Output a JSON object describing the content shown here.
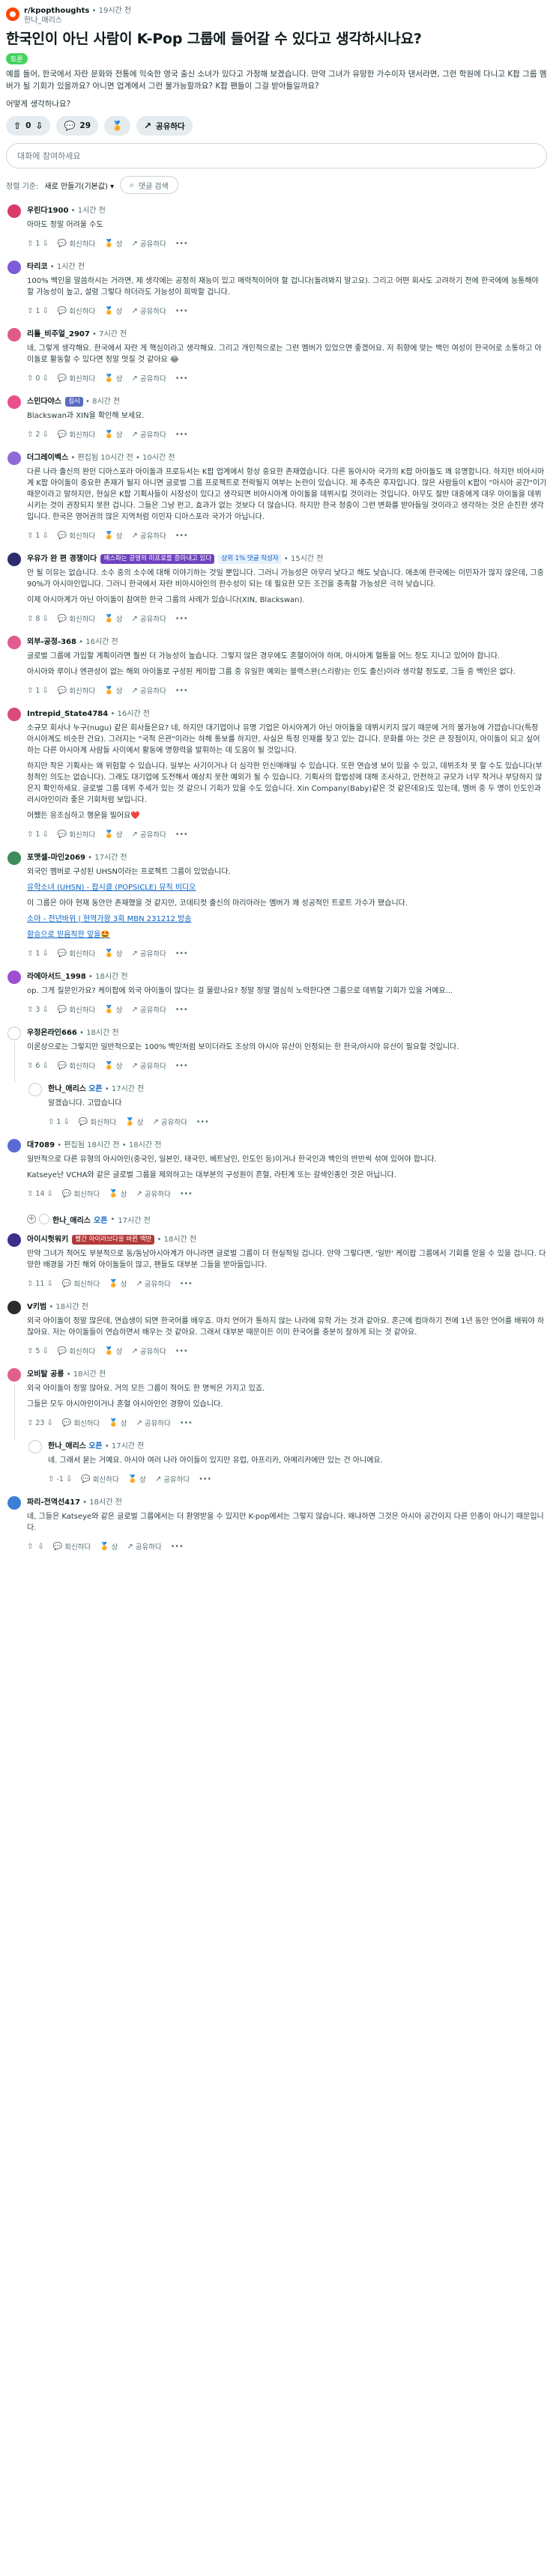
{
  "post": {
    "subreddit": "r/kpopthoughts",
    "time": "19시간 전",
    "author": "한나_애리스",
    "title": "한국인이 아닌 사람이 K-Pop 그룹에 들어갈 수 있다고 생각하시나요?",
    "flair": "토론",
    "body": [
      "예를 들어, 한국에서 자란 문화와 전통에 익숙한 영국 출신 소녀가 있다고 가정해 보겠습니다. 만약 그녀가 유망한 가수이자 댄서라면, 그런 학원에 다니고 K팝 그룹 멤버가 될 기회가 있을까요? 아니면 업계에서 그런 불가능할까요? K팝 팬들이 그걸 받아들일까요?",
      "어떻게 생각하나요?"
    ],
    "votes": "0",
    "comments_count": "29",
    "share_label": "공유하다"
  },
  "composer": {
    "placeholder": "대화에 참여하세요"
  },
  "sort": {
    "label": "정렬 기준:",
    "value": "새로 만들기(기본값)",
    "search_label": "댓글 검색"
  },
  "labels": {
    "reply": "회신하다",
    "award": "상",
    "share": "공유하다",
    "more": "•••",
    "edited": "편집됨"
  },
  "comments": [
    {
      "author": "우린다1900",
      "time": "1시간 전",
      "avatar_color": "#d93a6a",
      "body": [
        "아마도 정말 어려울 수도"
      ],
      "votes": "1"
    },
    {
      "author": "타리코",
      "time": "1시간 전",
      "avatar_color": "#7d5bd9",
      "body": [
        "100% 백인을 말씀하시는 거라면, 제 생각에는 공정히 재능이 있고 매력적이어야 할 겁니다(돌려봐지 말고요). 그리고 어떤 회사도 고려하기 전에 한국에에 능통해야 할 가능성이 높고, 설령 그렇다 하더라도 가능성이 희박할 겁니다."
      ],
      "votes": "1"
    },
    {
      "author": "리톨_비주얼_2907",
      "time": "7시간 전",
      "avatar_color": "#e05a8a",
      "body": [
        "네, 그렇게 생각해요. 한국에서 자란 게 핵심이라고 생각해요. 그리고 개인적으로는 그런 멤버가 있었으면 좋겠어요. 저 취향에 맞는 백인 여성이 한국어로 소통하고 아이돌로 활동할 수 있다면 정말 멋질 것 같아요 😂"
      ],
      "votes": "0"
    },
    {
      "author": "스민다야스",
      "time": "8시간 전",
      "avatar_color": "#e94f8b",
      "flair": "집시",
      "flair_color": "#5c6bc0",
      "body": [
        "Blackswan과 XIN을 확인해 보세요."
      ],
      "votes": "2"
    },
    {
      "author": "더그레이벡스",
      "time": "10시간 전",
      "edited": "10시간 전",
      "avatar_color": "#8e6bd8",
      "body": [
        "다른 나라 출신의 완인 디아스포라 아이돌과 프로듀서는 K팝 업계에서 항상 중요한 존재였습니다. 다른 동아시아 국가의 K팝 아이돌도 꽤 유명합니다. 하지만 비아시아계 K팝 아이돌이 중요한 존재가 될지 아니면 글로벌 그룹 프로젝트로 전락될지 여부는 논란이 있습니다. 제 추측은 후자입니다. 많은 사람들이 K팝이 \"아시아 공간\"이기 때문이라고 말하지만, 현실은 K팝 기획사들이 시장성이 있다고 생각되면 비아시아계 아이돌을 데뷔시킬 것이라는 것입니다. 아무도 절반 대중에게 대우 아이돌을 데뷔시키는 것이 권장되지 못한 겁니다. 그들은 그냥 펀고, 효과가 없는 것보다 더 많습니다. 하지만 한국 청중이 그런 변화를 받아들일 것이라고 생각하는 것은 순진한 생각입니다. 한국은 영어권의 많은 지역처럼 이민자 디아스포라 국가가 아닙니다."
      ],
      "votes": "1"
    },
    {
      "author": "우유가 완 편 경쟁이다",
      "time": "15시간 전",
      "avatar_color": "#2b2b6e",
      "flair": "예스파는 공영의 미프로를 증마내고 있다",
      "flair_color": "#6f42c1",
      "badge": "상위 1% 댓글 작성자",
      "body": [
        "안 될 이유는 없습니다. 소수 중의 소수에 대해 이야기하는 것일 뿐입니다. 그러니 가능성은 아무리 낮다고 해도 낮습니다. 애초에 한국에는 이민자가 많지 않은데, 그중 90%가 아시아인입니다. 그러니 한국에서 자란 비아시아인의 한수성이 되는 데 필요한 모든 조건을 충족할 가능성은 극히 낮습니다.",
        "이제 아시아계가 아닌 아이돌이 참여한 한국 그룹의 사례가 있습니다(XIN, Blackswan)."
      ],
      "votes": "8"
    },
    {
      "author": "외부-공정-368",
      "time": "16시간 전",
      "avatar_color": "#e15c8e",
      "body": [
        "글로벌 그룹에 가입할 계획이라면 훨씬 더 가능성이 높습니다. 그렇지 않은 경우에도 혼혈이어야 하며, 아시아계 혈통을 어느 정도 지니고 있어야 합니다.",
        "아시아와 루이나 엔관성이 없는 해외 아이돌로 구성된 케이팝 그룹 중 유일한 예외는 블랙스완(스리랑)는 인도 출신)이라 생각할 정도로, 그들 중 백인은 없다."
      ],
      "votes": "1"
    },
    {
      "author": "Intrepid_State4784",
      "time": "16시간 전",
      "avatar_color": "#d94c7a",
      "body": [
        "소규모 회사나 누구(nugu) 같은 회사들은요? 네, 하지만 대기업이나 유명 기업은 아시아계가 아닌 아이돌을 데뷔시키지 않기 때문에 거의 불가능에 가깝습니다(특정 아시아계도 비슷한 건요). 그러지는 \"국적 은관\"이라는 하해 통보를 하지만, 사실은 특정 인재를 찾고 있는 겁니다. 문화를 아는 것은 큰 장점이지, 아이돌이 되고 싶어 하는 다른 아시아계 사람들 사이에서 활동에 명향력을 발휘하는 데 도움이 될 것입니다.",
        "하지만 작은 기획사는 왜 위험할 수 있습니다. 일부는 사기이거나 더 심각한 인신매매일 수 있습니다. 또한 연습생 보이 있을 수 있고, 데뷔조차 못 할 수도 있습니다(부정적인 의도는 없습니다). 그래도 대기업에 도전해서 예상치 못한 예외가 될 수 있습니다. 기획사의 합법성에 대해 조사하고, 안전하고 규모가 너무 작거나 부당하지 않은지 확인하세요. 글로벌 그룹 데뷔 주세가 있는 것 같으니 기회가 있을 수도 있습니다. Xin Company(Baby)같은 것 같은데요)도 있는데, 멤버 중 두 명이 인도인과 러시아인이라 좋은 기회처럼 보입니다.",
        "어쨌든 응조심하고 행운을 빌어요❤️"
      ],
      "votes": "1"
    },
    {
      "author": "포맷셀-마인2069",
      "time": "17시간 전",
      "avatar_color": "#3d8c5a",
      "body": [
        "외국인 멤버로 구성된 UHSN이라는 프로젝트 그룹이 있었습니다.",
        "LINK:유학소녀 (UHSN) - 팝시클 (POPSICLE) 뮤직 비디오",
        "이 그룹은 아마 현재 동안만 존재했을 것 같지만, 코데티컷 출신의 마리아라는 멤버가 꽤 성공적인 트로트 가수가 됐습니다.",
        "LINK:소아 - 전년바위 | 현역가왕 3회 MBN 231212 방송",
        "LINK:함승으로 믿음직한 앞을🤩"
      ],
      "votes": "1"
    },
    {
      "author": "라에아서드_1998",
      "time": "18시간 전",
      "avatar_color": "#9c4fd0",
      "body": [
        "op. 그게 질문인가요? 케이팝에 외국 아이돌이 많다는 걸 몰랐나요? 정말 정말 열심히 노력한다면 그룹으로 데뷔할 기회가 있을 거예요..."
      ],
      "votes": "3"
    },
    {
      "author": "우정온라인666",
      "time": "18시간 전",
      "avatar_color": "#ffffff",
      "body": [
        "이론상으로는 그렇지만 일반적으로는 100% 백인처럼 보이더라도 조상의 아시아 유산이 인정되는 한 한국/아시아 유산이 필요할 것입니다."
      ],
      "votes": "6",
      "reply": {
        "author": "한나_애리스",
        "op": "오픈",
        "time": "17시간 전",
        "avatar_color": "#ffffff",
        "body": [
          "알겠습니다. 고맙습니다"
        ],
        "votes": "1"
      }
    },
    {
      "author": "대7089",
      "time": "18시간 전",
      "edited": "18시간 전",
      "avatar_color": "#5b6bd6",
      "body": [
        "일반적으로 다른 유형의 아시아인(중국인, 일본인, 태국인, 베트남인, 인도인 등)이거나 한국인과 백인의 반반씩 섞여 있어야 합니다.",
        "Katseye난 VCHA와 같은 글로벌 그룹을 제외하고는 대부분의 구성원이 흔혈, 라틴계 또는 갈색인종인 것은 아닙니다."
      ],
      "votes": "14",
      "reply_author": {
        "author": "한나_애리스",
        "op": "오픈",
        "time": "17시간 전"
      }
    },
    {
      "author": "아이시헛워키",
      "time": "18시간 전",
      "avatar_color": "#3b2f8c",
      "flair": "빨간 아이러브다을 바뀐 백반",
      "flair_color": "#b33a3a",
      "body": [
        "만약 그녀가 적어도 부분적으로 동/동남아시아계가 아니라면 글로벌 그룹이 더 현실적일 겁니다. 만약 그렇다면, '일반' 케이팝 그룹에서 기회를 얻을 수 있을 겁니다. 다양한 배경을 가진 해외 아이돌들이 많고, 팬들도 대부분 그들을 받아들입니다."
      ],
      "votes": "11"
    },
    {
      "author": "V키범",
      "time": "18시간 전",
      "avatar_color": "#2c2c2c",
      "body": [
        "외국 아이돌이 정말 많은데, 연습생이 되면 한국어를 배우죠. 마치 언어가 통하지 않는 나라에 유학 가는 것과 같아요. 혼근에 컴마하기 전에 1년 동안 언어를 배워야 하잖아요. 저는 아이돌들이 연습하면서 배우는 것 같아요. 그래서 대부분 때문이든 이미 한국어를 충분히 잘하게 되는 것 같아요."
      ],
      "votes": "5"
    },
    {
      "author": "오비탈 공릉",
      "time": "18시간 전",
      "avatar_color": "#e0608c",
      "body": [
        "외국 아이돌이 정말 많아요. 거의 모든 그룹이 적어도 한 명씩은 가지고 있죠.",
        "그들은 모두 아시아인이거나 혼혈 아시아인인 경향이 있습니다."
      ],
      "votes": "23",
      "reply": {
        "author": "한나_애리스",
        "op": "오픈",
        "time": "17시간 전",
        "avatar_color": "#ffffff",
        "body": [
          "네. 그래서 묻는 거예요. 아시아 여러 나라 아이들이 있지만 유럽, 아프리카, 아메리카에만 있는 건 아니에요."
        ],
        "votes": "-1"
      }
    },
    {
      "author": "파리-전역선417",
      "time": "18시간 전",
      "avatar_color": "#3d7fd6",
      "body": [
        "네, 그들은 Katseye와 같은 글로벌 그룹에서는 더 환영받을 수 있지만 K-pop에서는 그렇지 않습니다. 왜냐하면 그것은 아시아 공간이지 다른 인종이 아니기 때문입니다."
      ],
      "votes": ""
    }
  ]
}
